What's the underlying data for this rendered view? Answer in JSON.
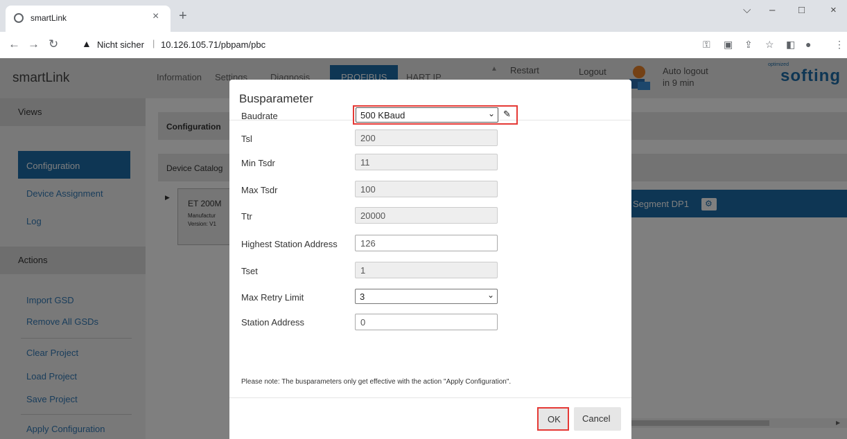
{
  "browser": {
    "tab_title": "smartLink",
    "tab_close": "×",
    "new_tab": "+",
    "win_minimize": "–",
    "win_maximize": "□",
    "win_close": "×",
    "win_dropdown": "⌵",
    "not_secure": "Nicht sicher",
    "url": "10.126.105.71/pbpam/pbc"
  },
  "header": {
    "brand": "smartLink",
    "nav": [
      "Information",
      "Settings",
      "Diagnosis",
      "PROFIBUS",
      "HART IP"
    ],
    "restart": "Restart",
    "logout": "Logout",
    "auto_logout_1": "Auto logout",
    "auto_logout_2": "in 9 min",
    "logo_small": "optimized",
    "logo": "softing"
  },
  "sidebar": {
    "views_heading": "Views",
    "views": [
      "Configuration",
      "Device Assignment",
      "Log"
    ],
    "actions_heading": "Actions",
    "actions": [
      "Import GSD",
      "Remove All GSDs",
      "Clear Project",
      "Load Project",
      "Save Project",
      "Apply Configuration"
    ]
  },
  "main": {
    "config_tab": "Configuration",
    "device_catalog": "Device Catalog",
    "device_name": "ET 200M",
    "device_manufacturer": "Manufactur",
    "device_version": "Version: V1",
    "segment": "Segment DP1"
  },
  "modal": {
    "title": "Busparameter",
    "fields": {
      "baudrate": {
        "label": "Baudrate",
        "value": "500 KBaud"
      },
      "tsl": {
        "label": "Tsl",
        "value": "200"
      },
      "min_tsdr": {
        "label": "Min Tsdr",
        "value": "11"
      },
      "max_tsdr": {
        "label": "Max Tsdr",
        "value": "100"
      },
      "ttr": {
        "label": "Ttr",
        "value": "20000"
      },
      "highest_station": {
        "label": "Highest Station Address",
        "value": "126"
      },
      "tset": {
        "label": "Tset",
        "value": "1"
      },
      "max_retry": {
        "label": "Max Retry Limit",
        "value": "3"
      },
      "station_address": {
        "label": "Station Address",
        "value": "0"
      }
    },
    "note": "Please note: The busparameters only get effective with the action \"Apply Configuration\".",
    "ok": "OK",
    "cancel": "Cancel"
  },
  "colors": {
    "accent_blue": "#1d6ca8",
    "highlight_red": "#e53935",
    "overlay": "rgba(0,0,0,0.5)"
  }
}
